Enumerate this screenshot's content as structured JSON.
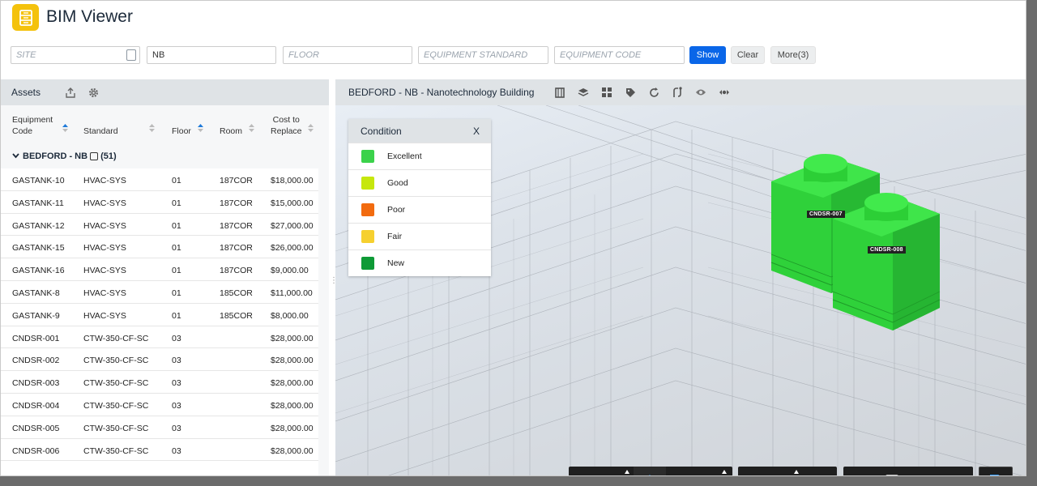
{
  "app": {
    "title": "BIM Viewer"
  },
  "filters": {
    "site_placeholder": "SITE",
    "building_value": "NB",
    "floor_placeholder": "FLOOR",
    "equipment_standard_placeholder": "EQUIPMENT STANDARD",
    "equipment_code_placeholder": "EQUIPMENT CODE",
    "show_label": "Show",
    "clear_label": "Clear",
    "more_label": "More(3)"
  },
  "assets": {
    "title": "Assets",
    "columns": {
      "code_line1": "Equipment",
      "code_line2": "Code",
      "standard": "Standard",
      "floor": "Floor",
      "room": "Room",
      "cost_line1": "Cost to",
      "cost_line2": "Replace"
    },
    "group": {
      "name": "BEDFORD - NB",
      "count": "(51)"
    },
    "rows": [
      {
        "code": "GASTANK-10",
        "standard": "HVAC-SYS",
        "floor": "01",
        "room": "187COR",
        "cost": "$18,000.00"
      },
      {
        "code": "GASTANK-11",
        "standard": "HVAC-SYS",
        "floor": "01",
        "room": "187COR",
        "cost": "$15,000.00"
      },
      {
        "code": "GASTANK-12",
        "standard": "HVAC-SYS",
        "floor": "01",
        "room": "187COR",
        "cost": "$27,000.00"
      },
      {
        "code": "GASTANK-15",
        "standard": "HVAC-SYS",
        "floor": "01",
        "room": "187COR",
        "cost": "$26,000.00"
      },
      {
        "code": "GASTANK-16",
        "standard": "HVAC-SYS",
        "floor": "01",
        "room": "187COR",
        "cost": "$9,000.00"
      },
      {
        "code": "GASTANK-8",
        "standard": "HVAC-SYS",
        "floor": "01",
        "room": "185COR",
        "cost": "$11,000.00"
      },
      {
        "code": "GASTANK-9",
        "standard": "HVAC-SYS",
        "floor": "01",
        "room": "185COR",
        "cost": "$8,000.00"
      },
      {
        "code": "CNDSR-001",
        "standard": "CTW-350-CF-SC",
        "floor": "03",
        "room": "",
        "cost": "$28,000.00"
      },
      {
        "code": "CNDSR-002",
        "standard": "CTW-350-CF-SC",
        "floor": "03",
        "room": "",
        "cost": "$28,000.00"
      },
      {
        "code": "CNDSR-003",
        "standard": "CTW-350-CF-SC",
        "floor": "03",
        "room": "",
        "cost": "$28,000.00"
      },
      {
        "code": "CNDSR-004",
        "standard": "CTW-350-CF-SC",
        "floor": "03",
        "room": "",
        "cost": "$28,000.00"
      },
      {
        "code": "CNDSR-005",
        "standard": "CTW-350-CF-SC",
        "floor": "03",
        "room": "",
        "cost": "$28,000.00"
      },
      {
        "code": "CNDSR-006",
        "standard": "CTW-350-CF-SC",
        "floor": "03",
        "room": "",
        "cost": "$28,000.00"
      }
    ]
  },
  "viewer": {
    "title": "BEDFORD - NB - Nanotechnology Building",
    "legend": {
      "title": "Condition",
      "close": "X",
      "items": [
        {
          "label": "Excellent",
          "color": "#3bd24b"
        },
        {
          "label": "Good",
          "color": "#c6e70d"
        },
        {
          "label": "Poor",
          "color": "#f26b0f"
        },
        {
          "label": "Fair",
          "color": "#f6d02f"
        },
        {
          "label": "New",
          "color": "#0e9a36"
        }
      ]
    },
    "tags": {
      "tag1": "CNDSR-007",
      "tag2": "CNDSR-008"
    },
    "model_color": "#2fd13a",
    "toolbar_icons": [
      "person-icon",
      "orbit-icon",
      "pan-icon",
      "dolly-icon",
      "camera-icon",
      "ruler-icon",
      "section-icon",
      "explode-icon",
      "model-tree-icon",
      "properties-icon",
      "settings-icon",
      "fullscreen-icon",
      "tag-icon"
    ]
  }
}
